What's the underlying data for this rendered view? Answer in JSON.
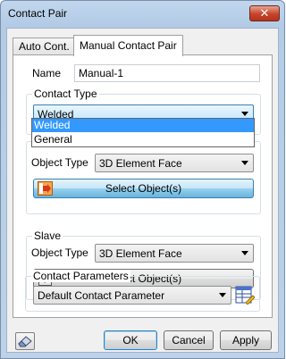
{
  "window": {
    "title": "Contact Pair",
    "close_glyph": "✕"
  },
  "tabs": [
    {
      "label": "Auto Cont."
    },
    {
      "label": "Manual Contact Pair"
    }
  ],
  "name": {
    "label": "Name",
    "value": "Manual-1"
  },
  "contact_type": {
    "title": "Contact Type",
    "selected": "Welded",
    "options": [
      "Welded",
      "General"
    ],
    "highlighted": "Welded"
  },
  "master": {
    "object_type_label": "Object Type",
    "object_type_value": "3D Element Face",
    "select_label": "Select Object(s)",
    "select_icon": "arrow-select-icon"
  },
  "slave": {
    "title": "Slave",
    "object_type_label": "Object Type",
    "object_type_value": "3D Element Face",
    "select_label": "Select Object(s)",
    "select_icon": "question-icon"
  },
  "contact_parameters": {
    "title": "Contact Parameters",
    "value": "Default Contact Parameter",
    "edit_icon": "parameter-table-icon"
  },
  "footer": {
    "ok_label": "OK",
    "cancel_label": "Cancel",
    "apply_label": "Apply",
    "left_icon": "eraser-icon"
  },
  "colors": {
    "selection": "#3399ff",
    "title_gradient": "#c2d7ee",
    "close_red": "#c7432b",
    "focus_blue": "#3c7fb1"
  }
}
